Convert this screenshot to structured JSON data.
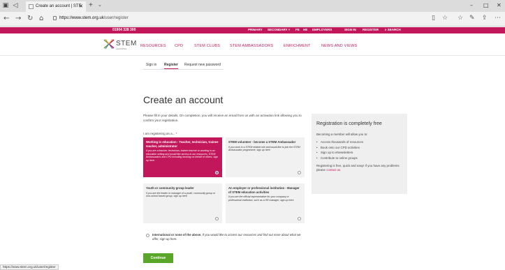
{
  "browser": {
    "tab_title": "Create an account | STE",
    "url_host": "https://www.stem.org.uk",
    "url_path": "/user/register",
    "status_url": "https://www.stem.org.uk/user/register"
  },
  "topbar": {
    "phone": "01904 328 300",
    "links": [
      "PRIMARY",
      "SECONDARY ˅",
      "FE",
      "HE",
      "EMPLOYERS",
      "SIGN IN",
      "REGISTER",
      "⌕ SEARCH"
    ]
  },
  "logo": {
    "word": "STEM",
    "sub": "LEARNING"
  },
  "nav": [
    "RESOURCES",
    "CPD",
    "STEM CLUBS",
    "STEM AMBASSADORS",
    "ENRICHMENT",
    "NEWS AND VIEWS"
  ],
  "subtabs": [
    "Sign in",
    "Register",
    "Request new password"
  ],
  "page": {
    "title": "Create an account",
    "intro": "Please fill in your details. On completion, you will receive an email from us with an activation link allowing you to confirm your registration.",
    "reg_label": "I am registering as a...",
    "required_mark": "*",
    "continue_label": "Continue"
  },
  "options": [
    {
      "title": "Working in education - Teacher, technician, trainee teacher, administrator",
      "desc": "If you are a teacher, technician, trainee teacher or working in an education setting and would like access to our resources, STEM Ambassadors and CPD including booking on behalf of others, sign up here."
    },
    {
      "title": "STEM volunteer - become a STEM Ambassador",
      "desc": "If you work in a STEM related role and would like to join the STEM Ambassador programme, sign up here."
    },
    {
      "title": "Youth or community group leader",
      "desc": "If you are the leader or manager of a youth, community group or non-school based group, sign up here."
    },
    {
      "title": "An employer or professional institution - Manager of STEM education activities",
      "desc": "If you are the official representative for your company or professional institution, such as a HR manager, sign up here."
    }
  ],
  "international": {
    "title": "International or none of the above.",
    "desc": "If you would like to access our resources and find out more about what we offer, sign up here."
  },
  "sidebar": {
    "title": "Registration is completely free",
    "lead": "Becoming a member will allow you to:",
    "items": [
      "Access thousands of resources",
      "Book onto our CPD activities",
      "Sign up to eNewsletters",
      "Contribute to online groups"
    ],
    "foot": "Registering is free, quick and easy! If you have any problems please",
    "foot_link": "contact us."
  },
  "colors": {
    "brand": "#c2185b",
    "continue": "#5aa629"
  }
}
